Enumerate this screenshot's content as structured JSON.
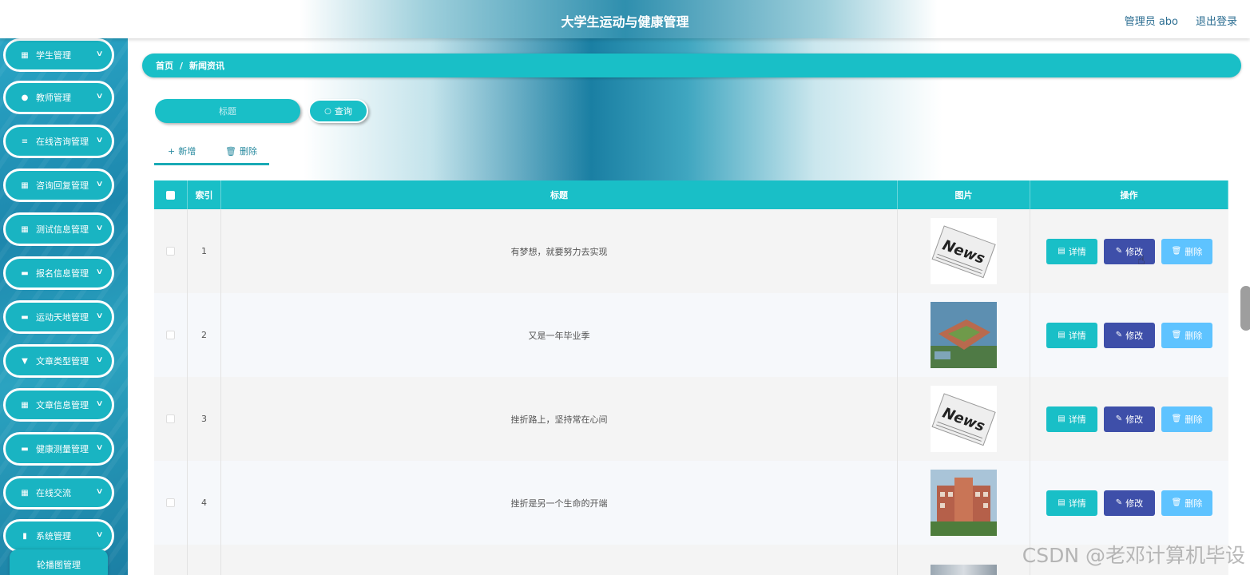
{
  "header": {
    "title": "大学生运动与健康管理",
    "user": "管理员 abo",
    "logout": "退出登录"
  },
  "sidebar": {
    "items": [
      {
        "label": "学生管理",
        "icon": "grid-icon",
        "glyph": "▦"
      },
      {
        "label": "教师管理",
        "icon": "user-icon",
        "glyph": "●"
      },
      {
        "label": "在线咨询管理",
        "icon": "list-icon",
        "glyph": "≡"
      },
      {
        "label": "咨询回复管理",
        "icon": "grid-icon",
        "glyph": "▦"
      },
      {
        "label": "测试信息管理",
        "icon": "grid-icon",
        "glyph": "▦"
      },
      {
        "label": "报名信息管理",
        "icon": "briefcase-icon",
        "glyph": "▬"
      },
      {
        "label": "运动天地管理",
        "icon": "chat-icon",
        "glyph": "▬"
      },
      {
        "label": "文章类型管理",
        "icon": "flag-icon",
        "glyph": "▼"
      },
      {
        "label": "文章信息管理",
        "icon": "grid-icon",
        "glyph": "▦"
      },
      {
        "label": "健康测量管理",
        "icon": "monitor-icon",
        "glyph": "▬"
      },
      {
        "label": "在线交流",
        "icon": "grid-icon",
        "glyph": "▦"
      },
      {
        "label": "系统管理",
        "icon": "clipboard-icon",
        "glyph": "▮"
      }
    ],
    "chevron": "∨",
    "sub_item": "轮播图管理"
  },
  "breadcrumb": {
    "home": "首页",
    "separator": "/",
    "current": "新闻资讯"
  },
  "search": {
    "placeholder": "标题",
    "button": "查询",
    "button_glyph": "○"
  },
  "actions": {
    "add": "新增",
    "add_glyph": "+",
    "delete": "删除",
    "delete_glyph": "🗑"
  },
  "table": {
    "headers": {
      "index": "索引",
      "title": "标题",
      "image": "图片",
      "operation": "操作"
    },
    "rows": [
      {
        "index": "1",
        "title": "有梦想，就要努力去实现",
        "image": "news"
      },
      {
        "index": "2",
        "title": "又是一年毕业季",
        "image": "campus"
      },
      {
        "index": "3",
        "title": "挫折路上，坚持常在心间",
        "image": "news"
      },
      {
        "index": "4",
        "title": "挫折是另一个生命的开端",
        "image": "building"
      }
    ],
    "buttons": {
      "detail": "详情",
      "edit": "修改",
      "delete": "删除"
    },
    "button_glyphs": {
      "detail": "▤",
      "edit": "✎",
      "delete": "🗑"
    }
  },
  "watermark": "CSDN @老邓计算机毕设",
  "colors": {
    "accent": "#19bfc7",
    "edit_button": "#3e4fa9",
    "delete_button": "#5ec3ff",
    "sidebar": "#1d87ad"
  }
}
